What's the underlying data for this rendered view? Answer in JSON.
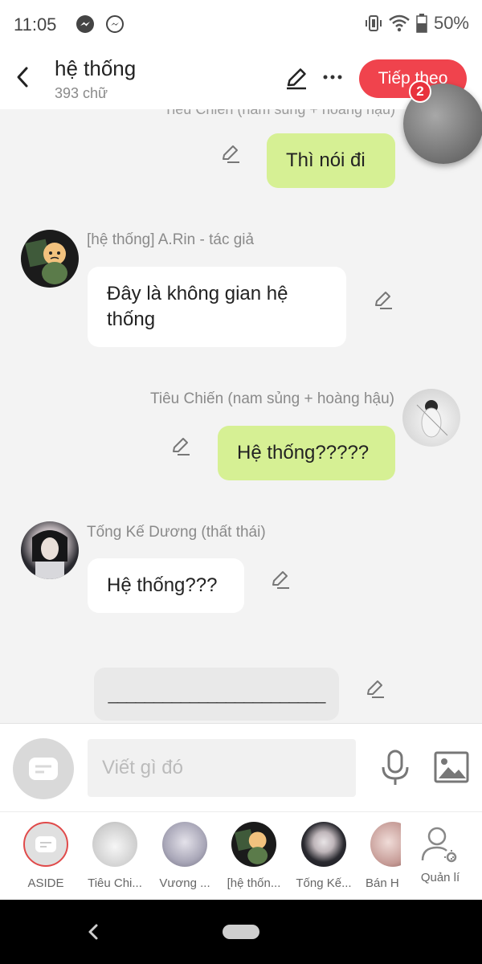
{
  "status_bar": {
    "time": "11:05",
    "battery": "50%"
  },
  "header": {
    "title": "hệ thống",
    "subtitle": "393 chữ",
    "next_label": "Tiếp theo",
    "badge_count": "2"
  },
  "chat": {
    "cut_sender": "Tiêu Chiến (nam sủng + hoàng hậu)",
    "messages": [
      {
        "sender": "",
        "text": "Thì nói đi",
        "side": "right"
      },
      {
        "sender": "[hệ thống] A.Rin - tác giả",
        "text": "Đây là không gian hệ thống",
        "side": "left"
      },
      {
        "sender": "Tiêu Chiến (nam sủng + hoàng hậu)",
        "text": "Hệ thống?????",
        "side": "right"
      },
      {
        "sender": "Tống Kế Dương (thất thái)",
        "text": "Hệ thống???",
        "side": "left"
      },
      {
        "sender": "",
        "text": "________________________",
        "side": "center"
      }
    ]
  },
  "input": {
    "placeholder": "Viết gì đó"
  },
  "characters": [
    {
      "label": "ASIDE"
    },
    {
      "label": "Tiêu Chi..."
    },
    {
      "label": "Vương ..."
    },
    {
      "label": "[hệ thốn..."
    },
    {
      "label": "Tống Kế..."
    },
    {
      "label": "Bán H"
    },
    {
      "label": "Quản lí"
    }
  ],
  "icons": {
    "status_left": [
      "messenger-icon",
      "messenger-icon"
    ],
    "status_right": [
      "vibrate-icon",
      "wifi-icon",
      "battery-icon"
    ],
    "header": [
      "back-icon",
      "pencil-icon",
      "more-icon"
    ],
    "input": [
      "aside-icon",
      "mic-icon",
      "image-icon"
    ],
    "nav": [
      "nav-back-icon",
      "nav-home-pill"
    ]
  },
  "colors": {
    "accent": "#f0434d",
    "my_bubble": "#d6f094",
    "their_bubble": "#ffffff",
    "background": "#f3f3f3"
  }
}
